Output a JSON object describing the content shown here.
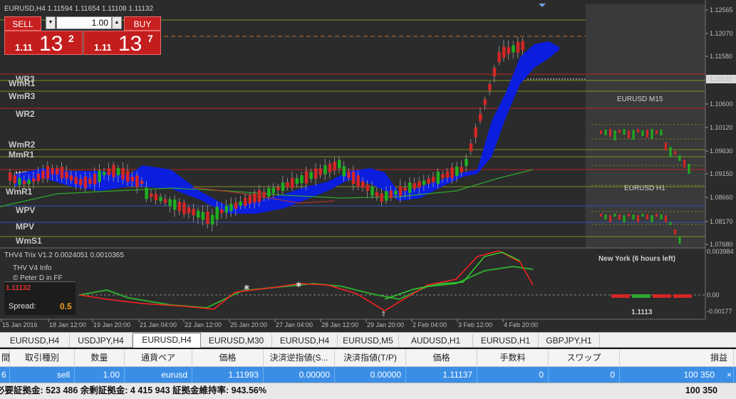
{
  "chart": {
    "symbol_header": "EURUSD,H4  1.11594 1.11654 1.11108 1.11132",
    "price_ticks": [
      "1.12565",
      "1.12070",
      "1.11580",
      "1.11132",
      "1.10600",
      "1.10120",
      "1.09630",
      "1.09150",
      "1.08660",
      "1.08170",
      "1.07680"
    ],
    "current_price": "1.11132",
    "time_labels": [
      "15 Jan 2016",
      "18 Jan 12:00",
      "19 Jan 20:00",
      "21 Jan 04:00",
      "22 Jan 12:00",
      "25 Jan 20:00",
      "27 Jan 04:00",
      "28 Jan 12:00",
      "29 Jan 20:00",
      "2 Feb 04:00",
      "3 Feb 12:00",
      "4 Feb 20:00"
    ],
    "levels": [
      "WR3",
      "WmR1",
      "WmR3",
      "WR2",
      "WmR2",
      "MmR1",
      "WR1",
      "WmR1",
      "WPV",
      "MPV",
      "WmS1"
    ],
    "mini_m15": "EURUSD  M15",
    "mini_h1": "EURUSD  H1",
    "indicator_title": "THV4 Trix V1.2 0.0024051 0.0010365",
    "indicator_ticks": [
      "0.003984",
      "0.00",
      "-0.00177"
    ],
    "session_text": "New York   (6 hours left)",
    "session_price": "1.1113",
    "info": {
      "title": "THV  V4  Info",
      "author": "© Peter D in FF",
      "price": "1.11132",
      "spread_label": "Spread:",
      "spread_value": "0.5"
    },
    "colors": {
      "bull": "#1fae1f",
      "bear": "#d42626",
      "cloud": "#0a1ee8",
      "accent_red": "#ff3030"
    }
  },
  "one_click": {
    "sell_label": "SELL",
    "buy_label": "BUY",
    "lot": "1.00",
    "sell_prefix": "1.11",
    "sell_big": "13",
    "sell_sup": "2",
    "buy_prefix": "1.11",
    "buy_big": "13",
    "buy_sup": "7"
  },
  "tabs": [
    "EURUSD,H4",
    "USDJPY,H4",
    "EURUSD,H4",
    "EURUSD,M30",
    "EURUSD,H4",
    "EURUSD,M5",
    "AUDUSD,H1",
    "EURUSD,H1",
    "GBPJPY,H1"
  ],
  "active_tab": 2,
  "table": {
    "headers": [
      "間",
      "取引種別",
      "数量",
      "通貨ペア",
      "価格",
      "決済逆指値(S...",
      "決済指値(T/P)",
      "価格",
      "手数料",
      "スワップ",
      "損益"
    ],
    "row": [
      "6",
      "sell",
      "1.00",
      "eurusd",
      "1.11993",
      "0.00000",
      "0.00000",
      "1.11137",
      "0",
      "0",
      "100 350"
    ]
  },
  "summary": {
    "text": "必要証拠金: 523 486  余剰証拠金: 4 415 943  証拠金維持率: 943.56%",
    "profit": "100 350"
  }
}
